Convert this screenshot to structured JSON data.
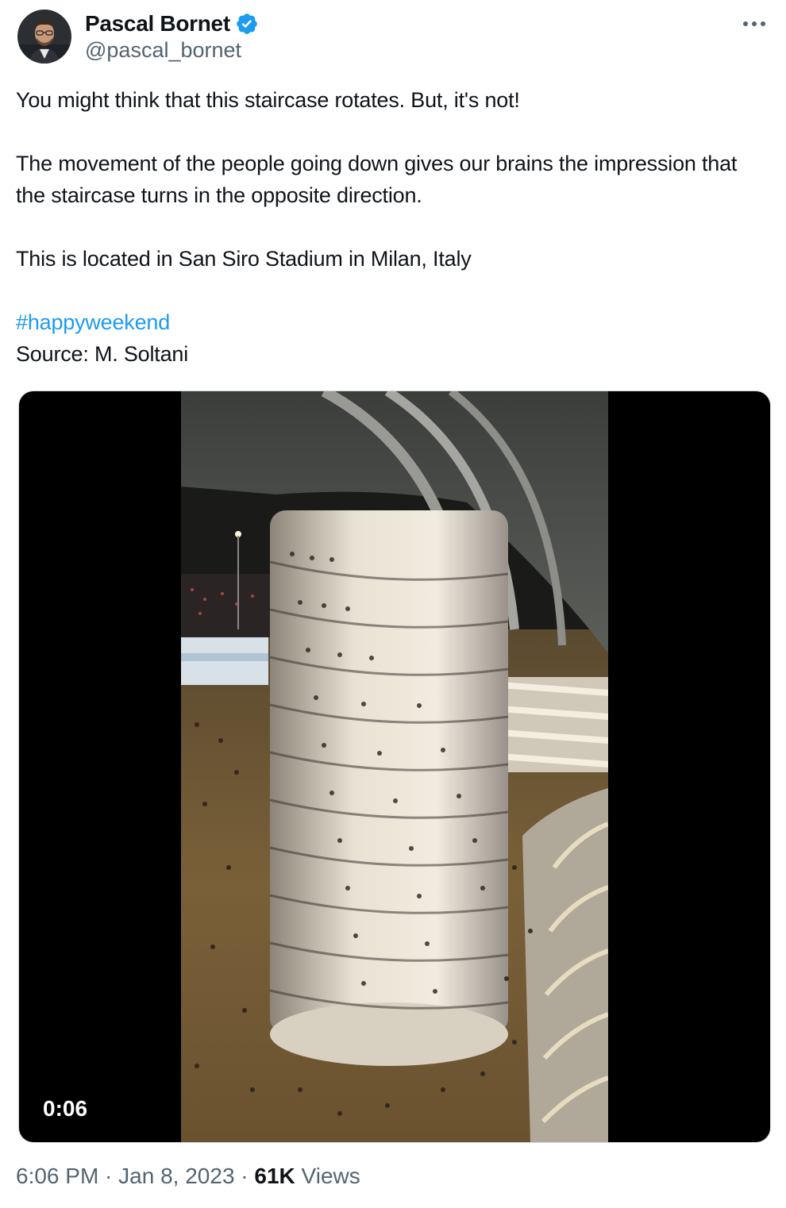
{
  "author": {
    "display_name": "Pascal Bornet",
    "handle": "@pascal_bornet",
    "verified": true,
    "verified_color": "#1d9bf0"
  },
  "tweet": {
    "paragraphs": [
      "You might think that this staircase rotates. But, it's not!",
      "The movement of the people going down gives our brains the impression that the staircase turns in the opposite direction.",
      "This is located in San Siro Stadium in Milan, Italy"
    ],
    "hashtag": "#happyweekend",
    "source_line": "Source: M. Soltani"
  },
  "media": {
    "type": "video",
    "duration": "0:06"
  },
  "meta": {
    "time": "6:06 PM",
    "separator": " · ",
    "date": "Jan 8, 2023",
    "views_count": "61K",
    "views_label": " Views"
  },
  "icons": {
    "more": "more-icon",
    "verified": "verified-badge-icon"
  },
  "colors": {
    "link": "#1d9bf0",
    "secondary_text": "#536471",
    "primary_text": "#0f1419"
  }
}
